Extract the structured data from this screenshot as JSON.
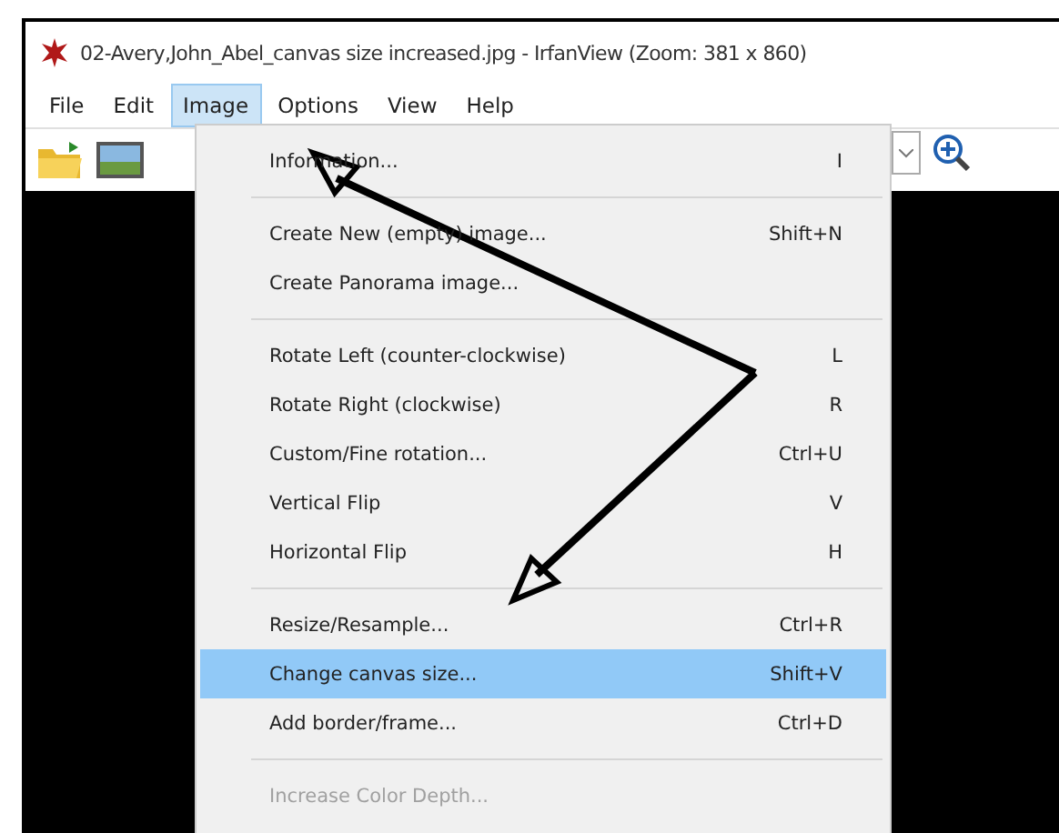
{
  "window": {
    "title": "02-Avery,John_Abel_canvas size increased.jpg - IrfanView (Zoom: 381 x 860)"
  },
  "menu_bar": [
    {
      "label": "File",
      "selected": false
    },
    {
      "label": "Edit",
      "selected": false
    },
    {
      "label": "Image",
      "selected": true
    },
    {
      "label": "Options",
      "selected": false
    },
    {
      "label": "View",
      "selected": false
    },
    {
      "label": "Help",
      "selected": false
    }
  ],
  "image_menu": [
    [
      {
        "label": "Information...",
        "shortcut": "I",
        "selected": false,
        "disabled": false
      }
    ],
    [
      {
        "label": "Create New (empty) image...",
        "shortcut": "Shift+N",
        "selected": false,
        "disabled": false
      },
      {
        "label": "Create Panorama image...",
        "selected": false,
        "disabled": false
      }
    ],
    [
      {
        "label": "Rotate Left (counter-clockwise)",
        "shortcut": "L",
        "selected": false,
        "disabled": false
      },
      {
        "label": "Rotate Right (clockwise)",
        "shortcut": "R",
        "selected": false,
        "disabled": false
      },
      {
        "label": "Custom/Fine rotation...",
        "shortcut": "Ctrl+U",
        "selected": false,
        "disabled": false
      },
      {
        "label": "Vertical Flip",
        "shortcut": "V",
        "selected": false,
        "disabled": false
      },
      {
        "label": "Horizontal Flip",
        "shortcut": "H",
        "selected": false,
        "disabled": false
      }
    ],
    [
      {
        "label": "Resize/Resample...",
        "shortcut": "Ctrl+R",
        "selected": false,
        "disabled": false
      },
      {
        "label": "Change canvas size...",
        "shortcut": "Shift+V",
        "selected": true,
        "disabled": false
      },
      {
        "label": "Add border/frame...",
        "shortcut": "Ctrl+D",
        "selected": false,
        "disabled": false
      }
    ],
    [
      {
        "label": "Increase Color Depth...",
        "selected": false,
        "disabled": true
      }
    ]
  ]
}
